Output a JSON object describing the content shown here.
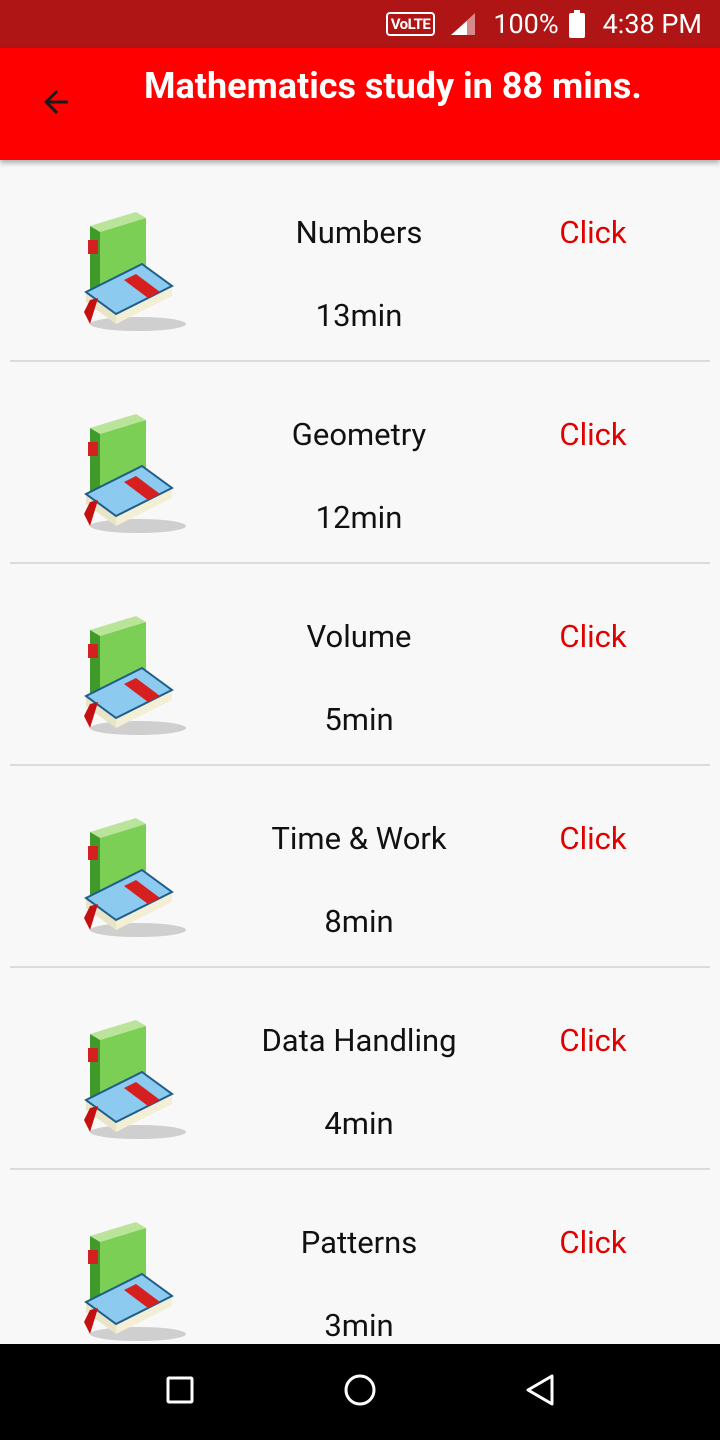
{
  "status_bar": {
    "volte": "VoLTE",
    "battery_percent": "100%",
    "time": "4:38 PM"
  },
  "app_bar": {
    "title": "Mathematics study in 88 mins.",
    "back_icon": "arrow-back-icon"
  },
  "topics": [
    {
      "name": "Numbers",
      "duration": "13min",
      "action": "Click",
      "icon": "book-icon"
    },
    {
      "name": "Geometry",
      "duration": "12min",
      "action": "Click",
      "icon": "book-icon"
    },
    {
      "name": "Volume",
      "duration": "5min",
      "action": "Click",
      "icon": "book-icon"
    },
    {
      "name": "Time & Work",
      "duration": "8min",
      "action": "Click",
      "icon": "book-icon"
    },
    {
      "name": "Data Handling",
      "duration": "4min",
      "action": "Click",
      "icon": "book-icon"
    },
    {
      "name": "Patterns",
      "duration": "3min",
      "action": "Click",
      "icon": "book-icon"
    }
  ],
  "nav_bar": {
    "recents_icon": "square-icon",
    "home_icon": "circle-icon",
    "back_icon": "triangle-back-icon"
  },
  "colors": {
    "status_bar": "#b01515",
    "app_bar": "#ff0000",
    "click_text": "#e00000",
    "background": "#f8f8f8"
  }
}
